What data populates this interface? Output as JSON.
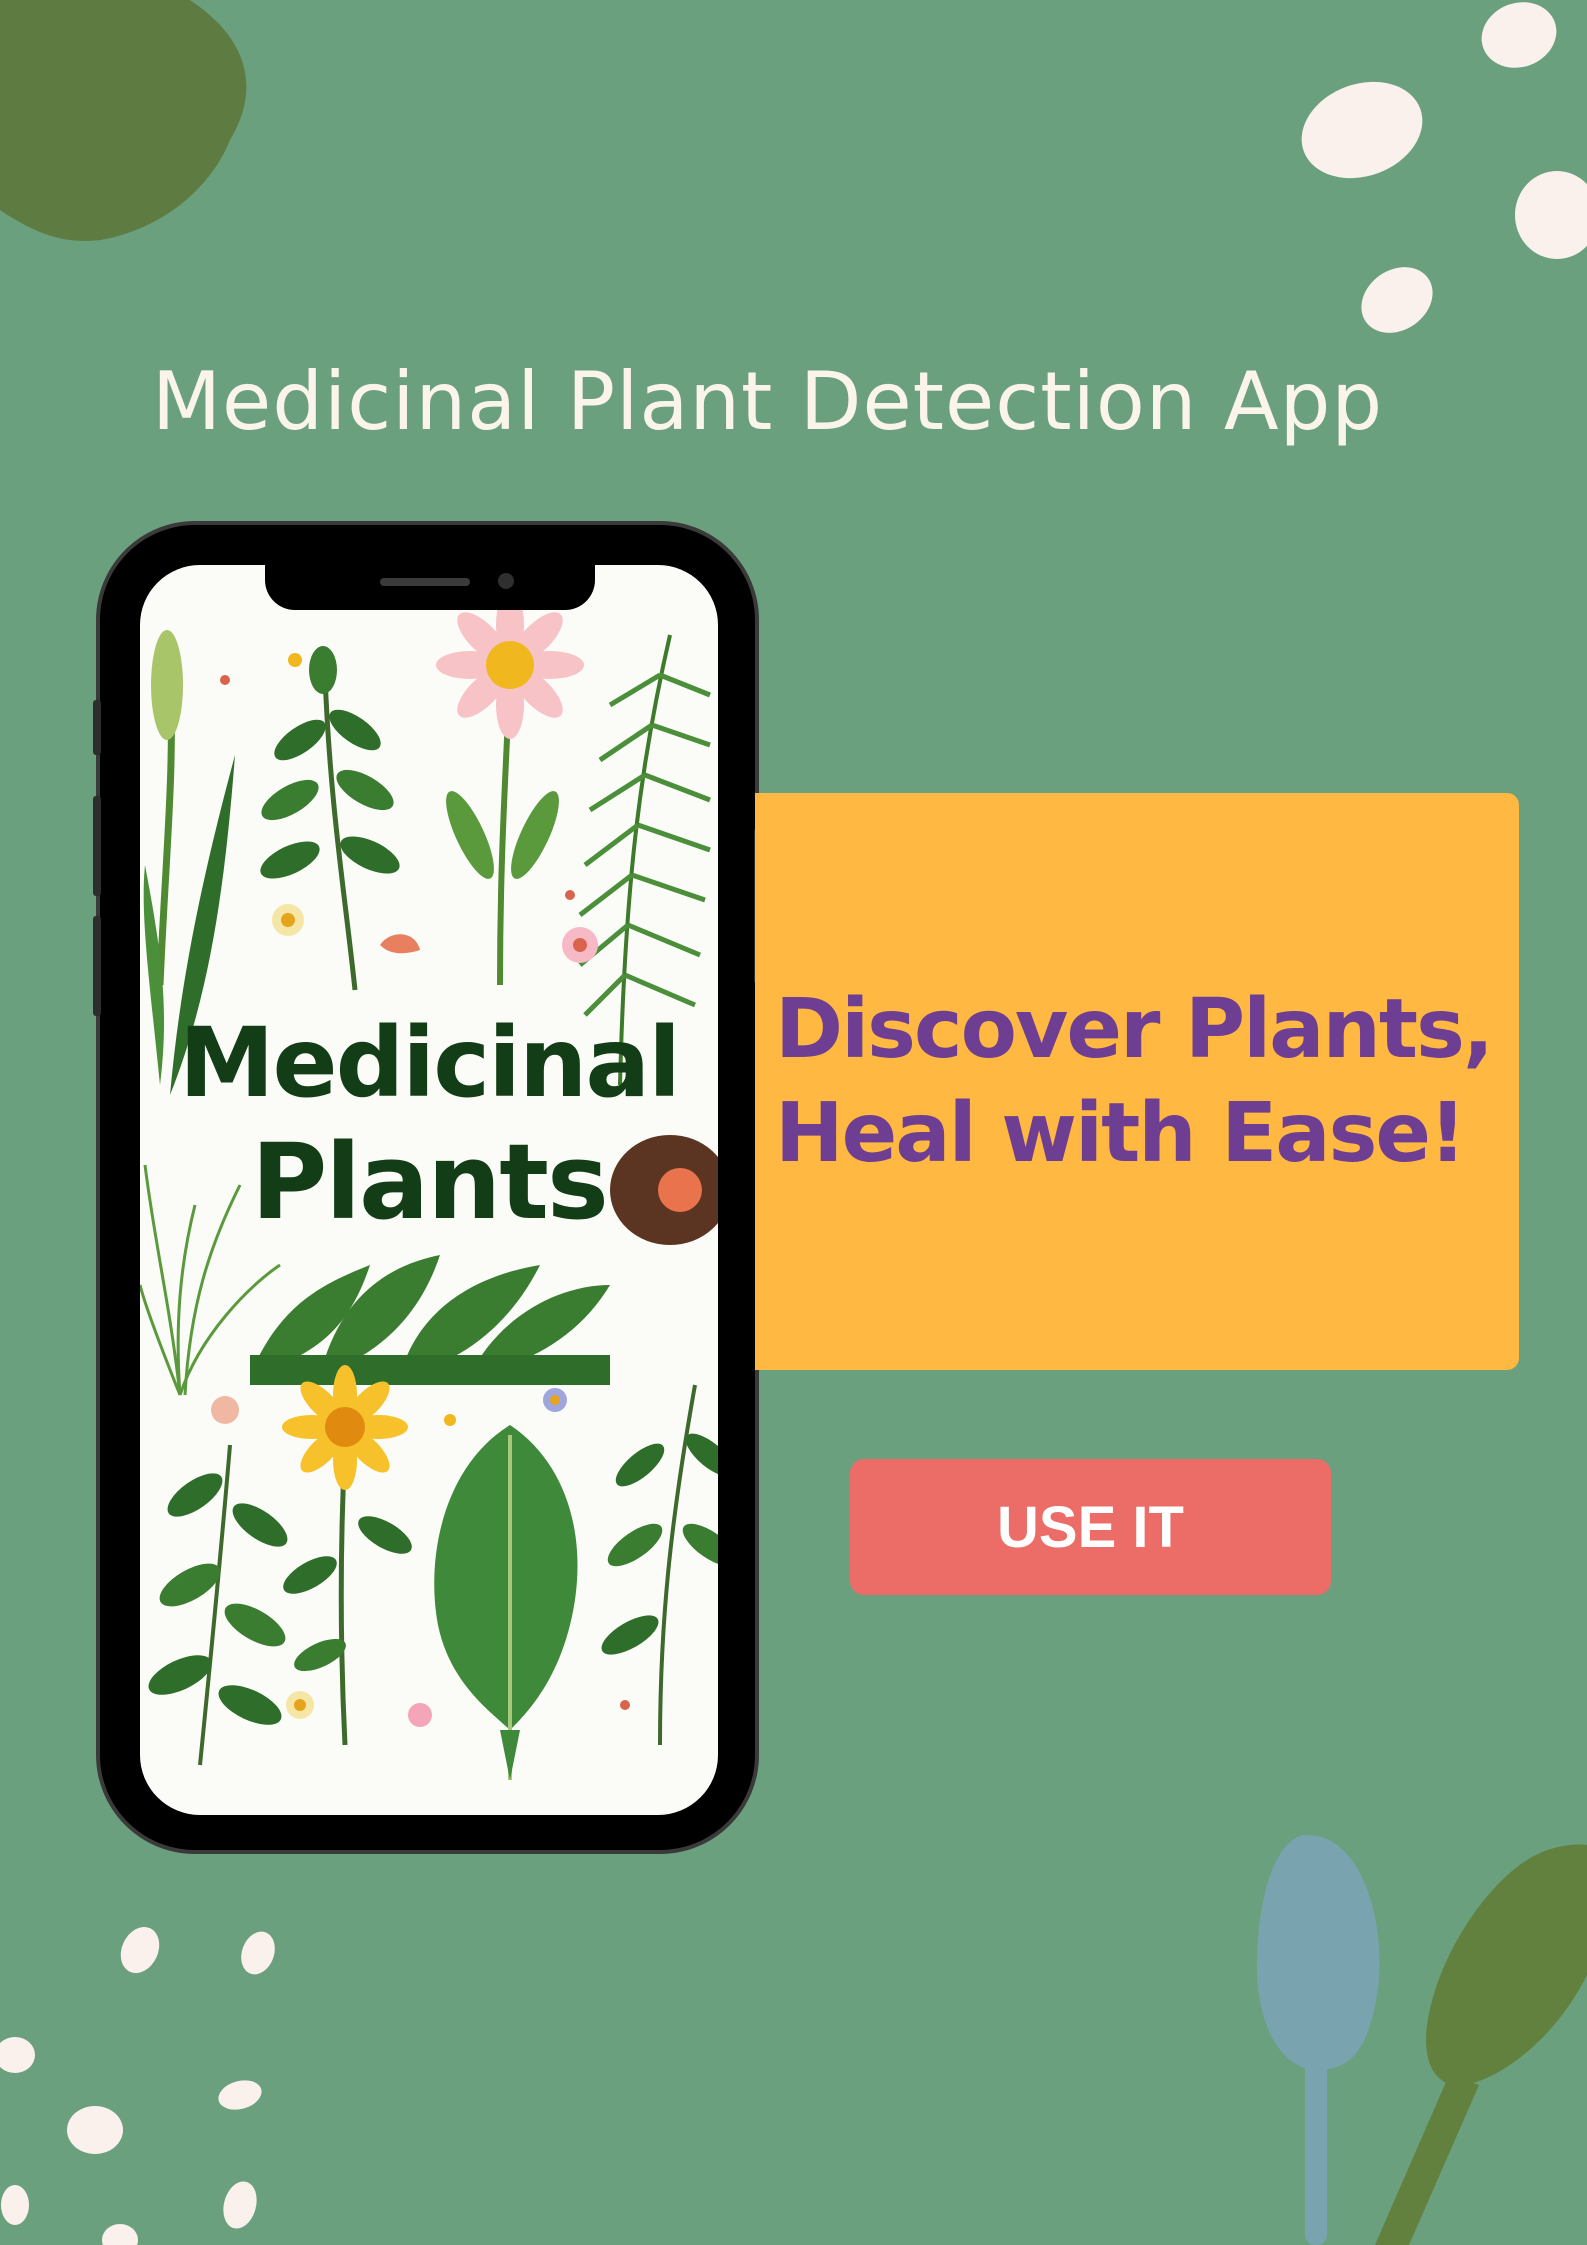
{
  "page": {
    "title": "Medicinal Plant Detection App"
  },
  "phone": {
    "screen_title_line1": "Medicinal",
    "screen_title_line2": "Plants"
  },
  "card": {
    "tagline_line1": "Discover Plants,",
    "tagline_line2": "Heal with Ease!"
  },
  "actions": {
    "use_button_label": "USE IT"
  },
  "colors": {
    "background": "#6ba07e",
    "card": "#ffb841",
    "tagline": "#6e3e93",
    "button": "#ec6c67",
    "title": "#fbf4ea"
  },
  "icons": {
    "decor": [
      "leaf-blob-icon",
      "pebble-dots-icon",
      "leaf-icon",
      "flower-icon"
    ]
  }
}
